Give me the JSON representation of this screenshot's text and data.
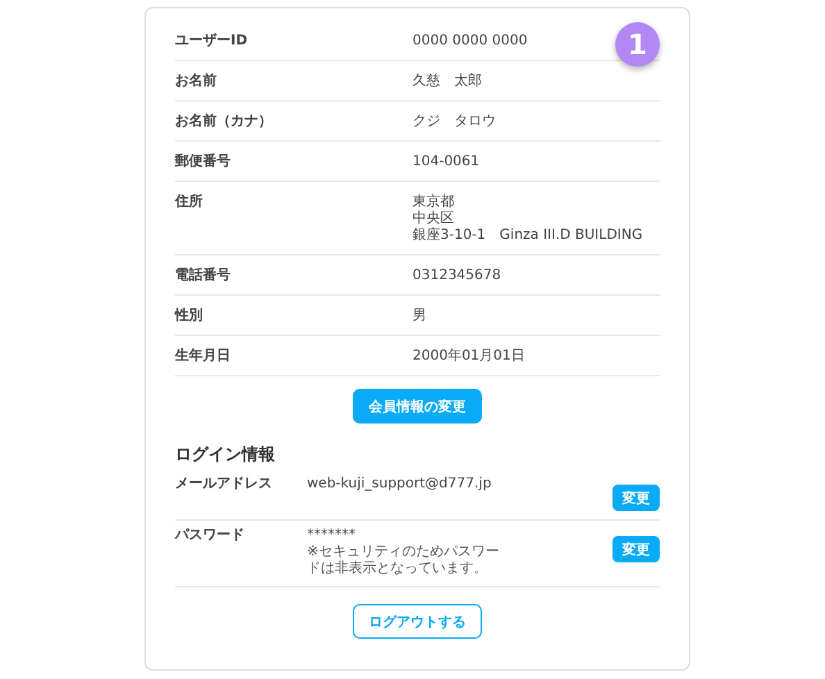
{
  "badge": "1",
  "profile": [
    {
      "label": "ユーザーID",
      "value": [
        "0000 0000 0000"
      ]
    },
    {
      "label": "お名前",
      "value": [
        "久慈　太郎"
      ]
    },
    {
      "label": "お名前（カナ）",
      "value": [
        "クジ　タロウ"
      ]
    },
    {
      "label": "郵便番号",
      "value": [
        "104-0061"
      ]
    },
    {
      "label": "住所",
      "value": [
        "東京都",
        "中央区",
        "銀座3-10-1　Ginza III.D BUILDING"
      ]
    },
    {
      "label": "電話番号",
      "value": [
        "0312345678"
      ]
    },
    {
      "label": "性別",
      "value": [
        "男"
      ]
    },
    {
      "label": "生年月日",
      "value": [
        "2000年01月01日"
      ]
    }
  ],
  "edit_button": "会員情報の変更",
  "login": {
    "heading": "ログイン情報",
    "rows": [
      {
        "label": "メールアドレス",
        "value": "web-kuji_support@d777.jp",
        "button": "変更"
      },
      {
        "label": "パスワード",
        "value": "*******",
        "note": "※セキュリティのためパスワードは非表示となっています。",
        "button": "変更"
      }
    ]
  },
  "logout_button": "ログアウトする"
}
